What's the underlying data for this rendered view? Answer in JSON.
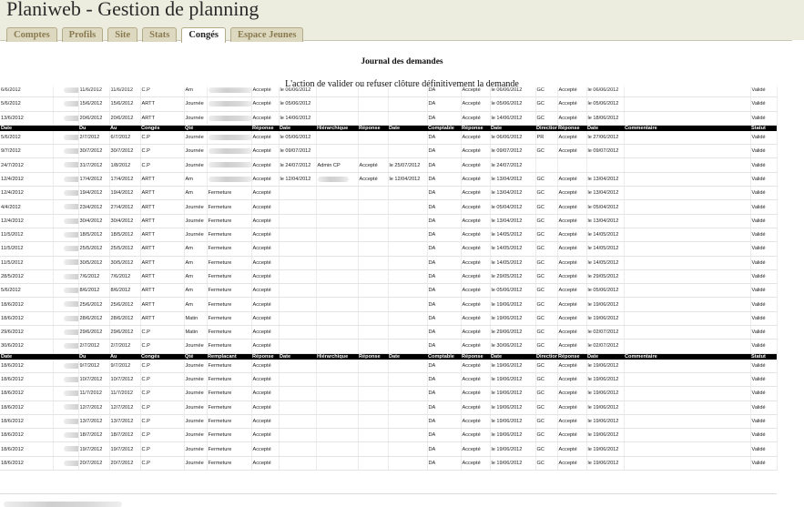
{
  "app": {
    "title": "Planiweb - Gestion de planning"
  },
  "tabs": [
    {
      "label": "Comptes",
      "active": false
    },
    {
      "label": "Profils",
      "active": false
    },
    {
      "label": "Site",
      "active": false
    },
    {
      "label": "Stats",
      "active": false
    },
    {
      "label": "Congés",
      "active": true
    },
    {
      "label": "Espace Jeunes",
      "active": false
    }
  ],
  "page": {
    "title": "Journal des demandes",
    "notice": "L'action de valider ou refuser clôture définitivement la demande"
  },
  "table": {
    "header_a": [
      "Date",
      "",
      "Du",
      "Au",
      "Congés",
      "Qté",
      "",
      "Réponse",
      "Date",
      "Hiérarchique",
      "Réponse",
      "Date",
      "Comptable",
      "Réponse",
      "Date",
      "Direction",
      "Réponse",
      "Date",
      "Commentaire",
      "Statut"
    ],
    "header_b": [
      "Date",
      "",
      "Du",
      "Au",
      "Congés",
      "Qté",
      "Remplacant",
      "Réponse",
      "Date",
      "Hiérarchique",
      "Réponse",
      "Date",
      "Comptable",
      "Réponse",
      "Date",
      "Direction",
      "Réponse",
      "Date",
      "Commentaire",
      "Statut"
    ],
    "group1": [
      [
        "6/6/2012",
        "",
        "11/6/2012",
        "11/6/2012",
        "C.P",
        "Am",
        "",
        "Accepté",
        "le 06/06/2012",
        "",
        "",
        "",
        "DA",
        "Accepté",
        "le 06/06/2012",
        "GC",
        "Accepté",
        "le 06/06/2012",
        "",
        "Validé"
      ],
      [
        "5/6/2012",
        "",
        "15/6/2012",
        "15/6/2012",
        "ARTT",
        "Journée",
        "",
        "Accepté",
        "le 05/06/2012",
        "",
        "",
        "",
        "DA",
        "Accepté",
        "le 05/06/2012",
        "GC",
        "Accepté",
        "le 05/06/2012",
        "",
        "Validé"
      ],
      [
        "13/6/2012",
        "",
        "20/6/2012",
        "20/6/2012",
        "ARTT",
        "Journée",
        "",
        "Accepté",
        "le 14/06/2012",
        "",
        "",
        "",
        "DA",
        "Accepté",
        "le 14/06/2012",
        "GC",
        "Accepté",
        "le 18/06/2012",
        "",
        "Validé"
      ]
    ],
    "group2": [
      [
        "5/6/2012",
        "",
        "2/7/2012",
        "6/7/2012",
        "C.P",
        "Journée",
        "",
        "Accepté",
        "le 05/06/2012",
        "",
        "",
        "",
        "DA",
        "Accepté",
        "le 06/06/2012",
        "PR",
        "Accepté",
        "le 27/06/2012",
        "",
        "Validé"
      ],
      [
        "9/7/2012",
        "",
        "30/7/2012",
        "30/7/2012",
        "C.P",
        "Journée",
        "",
        "Accepté",
        "le 09/07/2012",
        "",
        "",
        "",
        "DA",
        "Accepté",
        "le 09/07/2012",
        "GC",
        "Accepté",
        "le 09/07/2012",
        "",
        "Validé"
      ],
      [
        "24/7/2012",
        "",
        "31/7/2012",
        "1/8/2012",
        "C.P",
        "Journée",
        "",
        "Accepté",
        "le 24/07/2012",
        "Admin CP",
        "Accepté",
        "le 25/07/2012",
        "DA",
        "Accepté",
        "le 24/07/2012",
        "",
        "",
        "",
        "",
        "Validé"
      ],
      [
        "12/4/2012",
        "",
        "17/4/2012",
        "17/4/2012",
        "ARTT",
        "Am",
        "",
        "Accepté",
        "le 12/04/2012",
        "",
        "Accepté",
        "le 12/04/2012",
        "DA",
        "Accepté",
        "le 13/04/2012",
        "GC",
        "Accepté",
        "le 13/04/2012",
        "",
        "Validé"
      ],
      [
        "12/4/2012",
        "",
        "19/4/2012",
        "19/4/2012",
        "ARTT",
        "Am",
        "Fermeture",
        "Accepté",
        "",
        "",
        "",
        "",
        "DA",
        "Accepté",
        "le 13/04/2012",
        "GC",
        "Accepté",
        "le 13/04/2012",
        "",
        "Validé"
      ],
      [
        "4/4/2012",
        "",
        "23/4/2012",
        "27/4/2012",
        "ARTT",
        "Journée",
        "Fermeture",
        "Accepté",
        "",
        "",
        "",
        "",
        "DA",
        "Accepté",
        "le 05/04/2012",
        "GC",
        "Accepté",
        "le 05/04/2012",
        "",
        "Validé"
      ],
      [
        "12/4/2012",
        "",
        "30/4/2012",
        "30/4/2012",
        "ARTT",
        "Journée",
        "Fermeture",
        "Accepté",
        "",
        "",
        "",
        "",
        "DA",
        "Accepté",
        "le 13/04/2012",
        "GC",
        "Accepté",
        "le 13/04/2012",
        "",
        "Validé"
      ],
      [
        "11/5/2012",
        "",
        "18/5/2012",
        "18/5/2012",
        "ARTT",
        "Journée",
        "Fermeture",
        "Accepté",
        "",
        "",
        "",
        "",
        "DA",
        "Accepté",
        "le 14/05/2012",
        "GC",
        "Accepté",
        "le 14/05/2012",
        "",
        "Validé"
      ],
      [
        "11/5/2012",
        "",
        "25/5/2012",
        "25/5/2012",
        "ARTT",
        "Am",
        "Fermeture",
        "Accepté",
        "",
        "",
        "",
        "",
        "DA",
        "Accepté",
        "le 14/05/2012",
        "GC",
        "Accepté",
        "le 14/05/2012",
        "",
        "Validé"
      ],
      [
        "11/5/2012",
        "",
        "30/5/2012",
        "30/5/2012",
        "ARTT",
        "Am",
        "Fermeture",
        "Accepté",
        "",
        "",
        "",
        "",
        "DA",
        "Accepté",
        "le 14/05/2012",
        "GC",
        "Accepté",
        "le 14/05/2012",
        "",
        "Validé"
      ],
      [
        "28/5/2012",
        "",
        "7/6/2012",
        "7/6/2012",
        "ARTT",
        "Am",
        "Fermeture",
        "Accepté",
        "",
        "",
        "",
        "",
        "DA",
        "Accepté",
        "le 29/05/2012",
        "GC",
        "Accepté",
        "le 29/05/2012",
        "",
        "Validé"
      ],
      [
        "5/6/2012",
        "",
        "8/6/2012",
        "8/6/2012",
        "ARTT",
        "Am",
        "Fermeture",
        "Accepté",
        "",
        "",
        "",
        "",
        "DA",
        "Accepté",
        "le 05/06/2012",
        "GC",
        "Accepté",
        "le 05/06/2012",
        "",
        "Validé"
      ],
      [
        "18/6/2012",
        "",
        "25/6/2012",
        "25/6/2012",
        "ARTT",
        "Am",
        "Fermeture",
        "Accepté",
        "",
        "",
        "",
        "",
        "DA",
        "Accepté",
        "le 19/06/2012",
        "GC",
        "Accepté",
        "le 19/06/2012",
        "",
        "Validé"
      ],
      [
        "18/6/2012",
        "",
        "28/6/2012",
        "28/6/2012",
        "ARTT",
        "Matin",
        "Fermeture",
        "Accepté",
        "",
        "",
        "",
        "",
        "DA",
        "Accepté",
        "le 19/06/2012",
        "GC",
        "Accepté",
        "le 19/06/2012",
        "",
        "Validé"
      ],
      [
        "29/6/2012",
        "",
        "29/6/2012",
        "29/6/2012",
        "C.P",
        "Matin",
        "Fermeture",
        "Accepté",
        "",
        "",
        "",
        "",
        "DA",
        "Accepté",
        "le 29/06/2012",
        "GC",
        "Accepté",
        "le 02/07/2012",
        "",
        "Validé"
      ],
      [
        "30/6/2012",
        "",
        "2/7/2012",
        "2/7/2012",
        "C.P",
        "Journée",
        "Fermeture",
        "Accepté",
        "",
        "",
        "",
        "",
        "DA",
        "Accepté",
        "le 30/06/2012",
        "GC",
        "Accepté",
        "le 02/07/2012",
        "",
        "Validé"
      ]
    ],
    "group3": [
      [
        "18/6/2012",
        "",
        "9/7/2012",
        "9/7/2012",
        "C.P",
        "Journée",
        "Fermeture",
        "Accepté",
        "",
        "",
        "",
        "",
        "DA",
        "Accepté",
        "le 19/06/2012",
        "GC",
        "Accepté",
        "le 19/06/2012",
        "",
        "Validé"
      ],
      [
        "18/6/2012",
        "",
        "10/7/2012",
        "10/7/2012",
        "C.P",
        "Journée",
        "Fermeture",
        "Accepté",
        "",
        "",
        "",
        "",
        "DA",
        "Accepté",
        "le 19/06/2012",
        "GC",
        "Accepté",
        "le 19/06/2012",
        "",
        "Validé"
      ],
      [
        "18/6/2012",
        "",
        "11/7/2012",
        "11/7/2012",
        "C.P",
        "Journée",
        "Fermeture",
        "Accepté",
        "",
        "",
        "",
        "",
        "DA",
        "Accepté",
        "le 19/06/2012",
        "GC",
        "Accepté",
        "le 19/06/2012",
        "",
        "Validé"
      ],
      [
        "18/6/2012",
        "",
        "12/7/2012",
        "12/7/2012",
        "C.P",
        "Journée",
        "Fermeture",
        "Accepté",
        "",
        "",
        "",
        "",
        "DA",
        "Accepté",
        "le 19/06/2012",
        "GC",
        "Accepté",
        "le 19/06/2012",
        "",
        "Validé"
      ],
      [
        "18/6/2012",
        "",
        "13/7/2012",
        "13/7/2012",
        "C.P",
        "Journée",
        "Fermeture",
        "Accepté",
        "",
        "",
        "",
        "",
        "DA",
        "Accepté",
        "le 19/06/2012",
        "GC",
        "Accepté",
        "le 19/06/2012",
        "",
        "Validé"
      ],
      [
        "18/6/2012",
        "",
        "18/7/2012",
        "18/7/2012",
        "C.P",
        "Journée",
        "Fermeture",
        "Accepté",
        "",
        "",
        "",
        "",
        "DA",
        "Accepté",
        "le 19/06/2012",
        "GC",
        "Accepté",
        "le 19/06/2012",
        "",
        "Validé"
      ],
      [
        "18/6/2012",
        "",
        "19/7/2012",
        "19/7/2012",
        "C.P",
        "Journée",
        "Fermeture",
        "Accepté",
        "",
        "",
        "",
        "",
        "DA",
        "Accepté",
        "le 19/06/2012",
        "GC",
        "Accepté",
        "le 19/06/2012",
        "",
        "Validé"
      ],
      [
        "18/6/2012",
        "",
        "20/7/2012",
        "20/7/2012",
        "C.P",
        "Journée",
        "Fermeture",
        "Accepté",
        "",
        "",
        "",
        "",
        "DA",
        "Accepté",
        "le 19/06/2012",
        "GC",
        "Accepté",
        "le 19/06/2012",
        "",
        "Validé"
      ]
    ]
  }
}
